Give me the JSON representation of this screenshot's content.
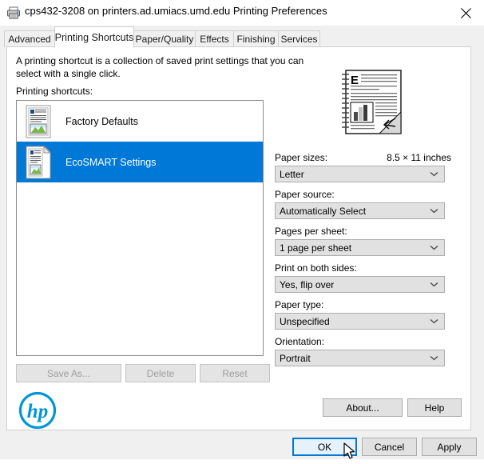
{
  "window": {
    "title": "cps432-3208 on printers.ad.umiacs.umd.edu Printing Preferences",
    "printer_icon": "printer-icon",
    "close_icon": "close-icon"
  },
  "tabs": [
    {
      "label": "Advanced",
      "active": false
    },
    {
      "label": "Printing Shortcuts",
      "active": true
    },
    {
      "label": "Paper/Quality",
      "active": false
    },
    {
      "label": "Effects",
      "active": false
    },
    {
      "label": "Finishing",
      "active": false
    },
    {
      "label": "Services",
      "active": false
    }
  ],
  "main": {
    "description": "A printing shortcut is a collection of saved print settings that you can select with a single click.",
    "list_label": "Printing shortcuts:",
    "shortcuts": [
      {
        "label": "Factory Defaults",
        "icon": "document-page-icon",
        "selected": false
      },
      {
        "label": "EcoSMART Settings",
        "icon": "document-pages-curl-icon",
        "selected": true
      }
    ],
    "preview_icon": "document-preview-icon"
  },
  "shortcut_buttons": [
    {
      "label": "Save As...",
      "disabled": true
    },
    {
      "label": "Delete",
      "disabled": true
    },
    {
      "label": "Reset",
      "disabled": true
    }
  ],
  "settings": [
    {
      "label": "Paper sizes:",
      "value": "Letter",
      "extra": "8.5 × 11 inches"
    },
    {
      "label": "Paper source:",
      "value": "Automatically Select",
      "extra": ""
    },
    {
      "label": "Pages per sheet:",
      "value": "1 page per sheet",
      "extra": ""
    },
    {
      "label": "Print on both sides:",
      "value": "Yes, flip over",
      "extra": ""
    },
    {
      "label": "Paper type:",
      "value": "Unspecified",
      "extra": ""
    },
    {
      "label": "Orientation:",
      "value": "Portrait",
      "extra": ""
    }
  ],
  "help_buttons": [
    {
      "label": "About..."
    },
    {
      "label": "Help"
    }
  ],
  "action_buttons": [
    {
      "label": "OK",
      "default": true
    },
    {
      "label": "Cancel",
      "default": false
    },
    {
      "label": "Apply",
      "default": false
    }
  ],
  "brand": {
    "logo": "hp-logo",
    "logo_text": "hp",
    "logo_color": "#0096d6"
  },
  "colors": {
    "selection": "#0078d7",
    "dialog_bg": "#f0f0f0",
    "panel_bg": "#ffffff",
    "button_face": "#e1e1e1",
    "disabled_text": "#9d9d9d"
  },
  "cursor": {
    "icon": "mouse-pointer-icon"
  }
}
